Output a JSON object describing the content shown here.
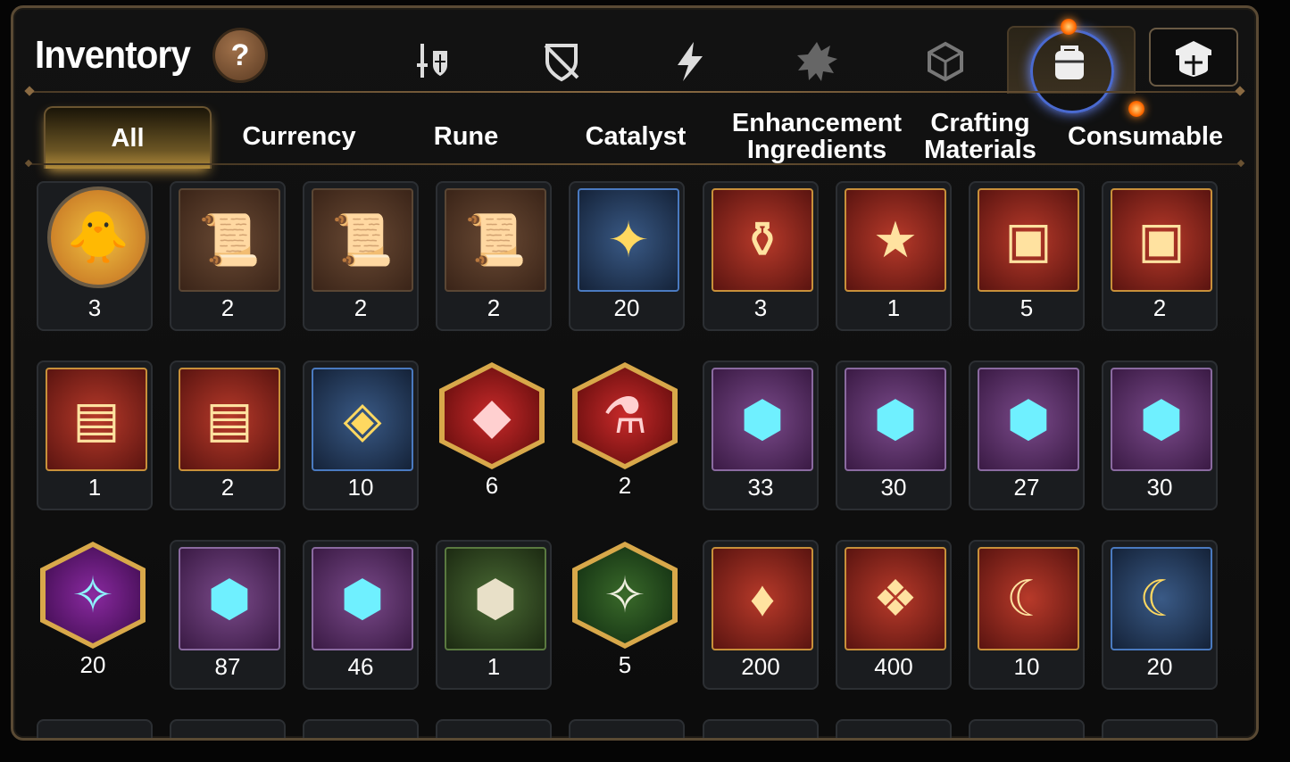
{
  "header": {
    "title": "Inventory",
    "help_label": "?"
  },
  "categories": [
    {
      "name": "equipment-icon"
    },
    {
      "name": "shield-off-icon"
    },
    {
      "name": "lightning-icon"
    },
    {
      "name": "rune-splat-icon"
    },
    {
      "name": "cube-icon"
    },
    {
      "name": "backpack-icon",
      "active": true
    },
    {
      "name": "guild-shield-icon"
    }
  ],
  "tabs": [
    "All",
    "Currency",
    "Rune",
    "Catalyst",
    "Enhancement\nIngredients",
    "Crafting\nMaterials",
    "Consumable"
  ],
  "active_tab": "All",
  "items": [
    {
      "icon": "pet-token-icon",
      "glyph": "🐥",
      "frame": "round",
      "qty": "3"
    },
    {
      "icon": "scroll-upgrade-icon",
      "glyph": "📜",
      "frame": "brown",
      "qty": "2"
    },
    {
      "icon": "rainbow-scroll-upgrade-icon",
      "glyph": "📜",
      "frame": "brown",
      "qty": "2"
    },
    {
      "icon": "scroll-upgrade-icon",
      "glyph": "📜",
      "frame": "brown",
      "qty": "2"
    },
    {
      "icon": "gold-fragments-icon",
      "glyph": "✦",
      "frame": "blue",
      "qty": "20"
    },
    {
      "icon": "red-potion-icon",
      "glyph": "⚱",
      "frame": "red",
      "qty": "3"
    },
    {
      "icon": "star-wand-icon",
      "glyph": "★",
      "frame": "red",
      "qty": "1"
    },
    {
      "icon": "white-chest-icon",
      "glyph": "▣",
      "frame": "red",
      "qty": "5"
    },
    {
      "icon": "blue-chest-icon",
      "glyph": "▣",
      "frame": "red",
      "qty": "2"
    },
    {
      "icon": "gold-chest-icon",
      "glyph": "▤",
      "frame": "red",
      "qty": "1"
    },
    {
      "icon": "gold-chest-icon",
      "glyph": "▤",
      "frame": "red",
      "qty": "2"
    },
    {
      "icon": "silver-cube-icon",
      "glyph": "◈",
      "frame": "blue",
      "qty": "10"
    },
    {
      "icon": "red-gem-icon",
      "glyph": "◆",
      "frame": "hex",
      "qty": "6"
    },
    {
      "icon": "pink-potion-icon",
      "glyph": "⚗",
      "frame": "hex",
      "qty": "2"
    },
    {
      "icon": "sword-rune-stone-icon",
      "glyph": "⬢",
      "frame": "purple",
      "qty": "33"
    },
    {
      "icon": "helmet-rune-stone-icon",
      "glyph": "⬢",
      "frame": "purple",
      "qty": "30"
    },
    {
      "icon": "armor-rune-stone-icon",
      "glyph": "⬢",
      "frame": "purple",
      "qty": "27"
    },
    {
      "icon": "boot-rune-stone-icon",
      "glyph": "⬢",
      "frame": "purple",
      "qty": "30"
    },
    {
      "icon": "star-rune-stone-icon",
      "glyph": "✧",
      "frame": "hex violet",
      "qty": "20"
    },
    {
      "icon": "hammer-rune-stone-icon",
      "glyph": "⬢",
      "frame": "purple",
      "qty": "87"
    },
    {
      "icon": "bolt-rune-stone-icon",
      "glyph": "⬢",
      "frame": "purple",
      "qty": "46"
    },
    {
      "icon": "white-sword-stone-icon",
      "glyph": "⬢",
      "frame": "green",
      "qty": "1"
    },
    {
      "icon": "white-star-stone-icon",
      "glyph": "✧",
      "frame": "hex forest",
      "qty": "5"
    },
    {
      "icon": "ember-crystal-icon",
      "glyph": "♦",
      "frame": "red",
      "qty": "200"
    },
    {
      "icon": "blue-crystal-shard-icon",
      "glyph": "❖",
      "frame": "red",
      "qty": "400"
    },
    {
      "icon": "moon-gem-icon",
      "glyph": "☾",
      "frame": "red",
      "qty": "10"
    },
    {
      "icon": "moon-triangle-gem-icon",
      "glyph": "☾",
      "frame": "blue",
      "qty": "20"
    }
  ],
  "colors": {
    "accent_gold": "#d8a84a",
    "panel_border": "#5a4a34",
    "active_ring": "#6d8cff",
    "badge_orange": "#ff6a00"
  }
}
